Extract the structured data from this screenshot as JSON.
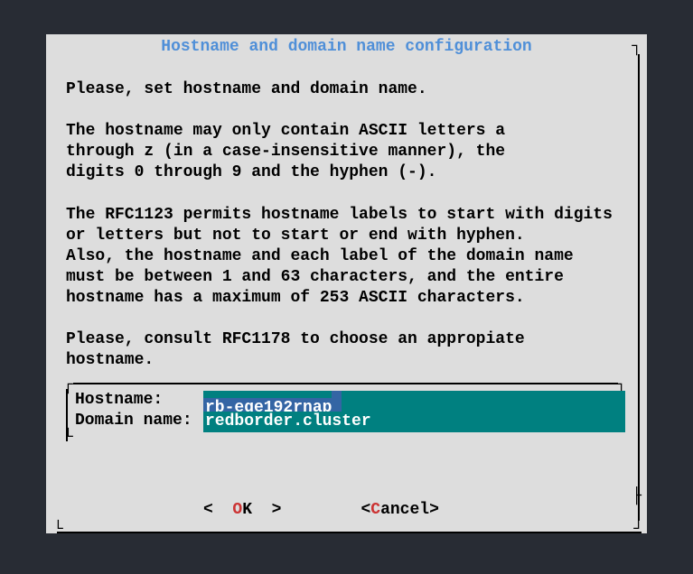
{
  "dialog": {
    "title": "Hostname and domain name configuration",
    "body": "Please, set hostname and domain name.\n\nThe hostname may only contain ASCII letters a\nthrough z (in a case-insensitive manner), the\ndigits 0 through 9 and the hyphen (-).\n\nThe RFC1123 permits hostname labels to start with digits\nor letters but not to start or end with hyphen.\nAlso, the hostname and each label of the domain name\nmust be between 1 and 63 characters, and the entire\nhostname has a maximum of 253 ASCII characters.\n\nPlease, consult RFC1178 to choose an appropiate\nhostname."
  },
  "form": {
    "hostname_label": "Hostname:",
    "hostname_value": "rb-eqe192rnap",
    "domain_label": "Domain name:",
    "domain_value": "redborder.cluster"
  },
  "buttons": {
    "ok_open": "<  ",
    "ok_hot": "O",
    "ok_rest": "K  >",
    "cancel_open": "<",
    "cancel_hot": "C",
    "cancel_rest": "ancel>"
  }
}
